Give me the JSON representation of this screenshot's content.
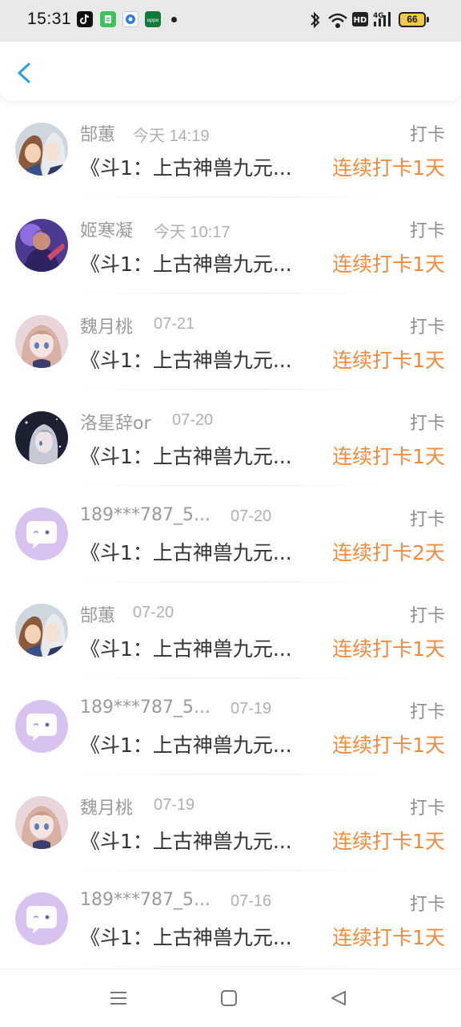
{
  "status_bar": {
    "time": "15:31",
    "battery": "66",
    "icons": [
      "tiktok-icon",
      "app-icon-green",
      "app-icon-blue",
      "app-icon-darkgreen",
      "bluetooth-icon",
      "wifi-icon",
      "hd-icon",
      "signal-4g-icon",
      "battery-icon"
    ]
  },
  "header": {
    "back_icon": "chevron-left-icon",
    "accent": "#2a9fd8"
  },
  "colors": {
    "streak": "#f08a3c",
    "name": "#9a9a9a",
    "avatar_default": "#d8c2f0"
  },
  "rows": [
    {
      "name": "郜蕙",
      "time": "今天 14:19",
      "tag": "打卡",
      "message": "《斗1：上古神兽九元...",
      "streak": "连续打卡1天",
      "avatar": "anime-couple"
    },
    {
      "name": "姬寒凝",
      "time": "今天 10:17",
      "tag": "打卡",
      "message": "《斗1：上古神兽九元...",
      "streak": "连续打卡1天",
      "avatar": "hero-purple"
    },
    {
      "name": "魏月桃",
      "time": "07-21",
      "tag": "打卡",
      "message": "《斗1：上古神兽九元...",
      "streak": "连续打卡1天",
      "avatar": "anime-girl-pink"
    },
    {
      "name": "洛星辞or",
      "time": "07-20",
      "tag": "打卡",
      "message": "《斗1：上古神兽九元...",
      "streak": "连续打卡1天",
      "avatar": "anime-girl-dark"
    },
    {
      "name": "189***787_5...",
      "time": "07-20",
      "tag": "打卡",
      "message": "《斗1：上古神兽九元...",
      "streak": "连续打卡2天",
      "avatar": "default-chat"
    },
    {
      "name": "郜蕙",
      "time": "07-20",
      "tag": "打卡",
      "message": "《斗1：上古神兽九元...",
      "streak": "连续打卡1天",
      "avatar": "anime-couple"
    },
    {
      "name": "189***787_5...",
      "time": "07-19",
      "tag": "打卡",
      "message": "《斗1：上古神兽九元...",
      "streak": "连续打卡1天",
      "avatar": "default-chat"
    },
    {
      "name": "魏月桃",
      "time": "07-19",
      "tag": "打卡",
      "message": "《斗1：上古神兽九元...",
      "streak": "连续打卡1天",
      "avatar": "anime-girl-pink"
    },
    {
      "name": "189***787_5...",
      "time": "07-16",
      "tag": "打卡",
      "message": "《斗1：上古神兽九元...",
      "streak": "连续打卡1天",
      "avatar": "default-chat"
    }
  ],
  "nav_bar": {
    "icons": [
      "menu-icon",
      "home-square-icon",
      "back-triangle-icon"
    ]
  }
}
